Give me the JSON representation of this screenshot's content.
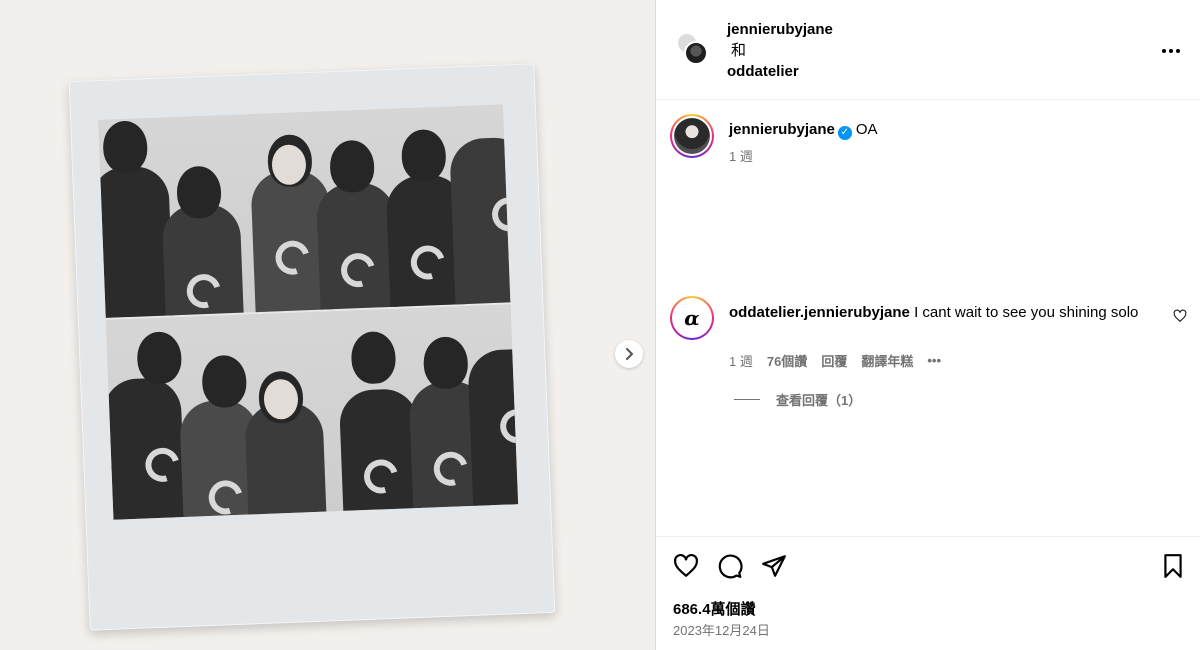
{
  "media": {
    "next_icon": "chevron-right-icon"
  },
  "header": {
    "author1": "jennierubyjane",
    "and_text": "和",
    "author2": "oddatelier",
    "more_icon": "more-horizontal-icon"
  },
  "post": {
    "username": "jennierubyjane",
    "verified_icon": "verified-badge-icon",
    "caption": "OA",
    "time": "1 週"
  },
  "comment": {
    "username": "oddatelier.",
    "mention": "jennierubyjane",
    "text": " I cant wait to see you shining solo",
    "avatar_text": "α",
    "time": "1 週",
    "likes": "76個讚",
    "reply_label": "回覆",
    "translate_label": "翻譯年糕",
    "more_label": "•••",
    "view_replies": "查看回覆（1）"
  },
  "footer": {
    "likes": "686.4萬個讚",
    "date": "2023年12月24日"
  },
  "colors": {
    "accent_blue": "#0095f6",
    "muted_text": "#737373",
    "media_bg": "#f3efec"
  }
}
